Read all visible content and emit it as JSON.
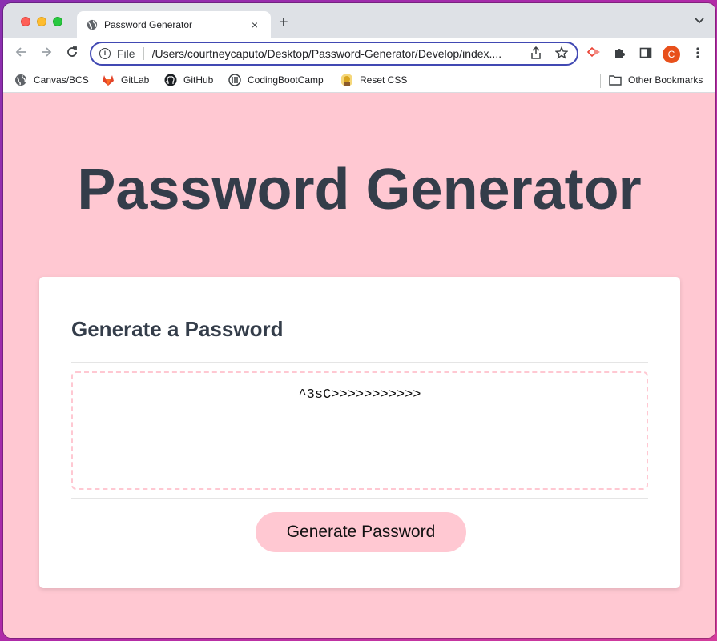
{
  "browser": {
    "tab": {
      "title": "Password Generator",
      "close": "×"
    },
    "new_tab": "+",
    "tab_menu": "⌄",
    "omnibox": {
      "scheme": "File",
      "url": "/Users/courtneycaputo/Desktop/Password-Generator/Develop/index...."
    },
    "profile_initial": "C",
    "bookmarks": [
      {
        "label": "Canvas/BCS",
        "icon": "globe-icon",
        "color": "#5f6368"
      },
      {
        "label": "GitLab",
        "icon": "gitlab-icon",
        "color": "#e24329"
      },
      {
        "label": "GitHub",
        "icon": "github-icon",
        "color": "#1b1f23"
      },
      {
        "label": "CodingBootCamp",
        "icon": "bootcamp-icon",
        "color": "#3c4043"
      },
      {
        "label": "Reset CSS",
        "icon": "reset-css-icon",
        "color": "#d9a520"
      }
    ],
    "other_bookmarks": "Other Bookmarks"
  },
  "page": {
    "title": "Password Generator",
    "card": {
      "header": "Generate a Password",
      "password": "^3sC>>>>>>>>>>>",
      "button": "Generate Password"
    }
  },
  "colors": {
    "page_bg": "#ffc8d2",
    "title_text": "#343d4a",
    "button_bg": "#ffc8d2",
    "omnibox_focus": "#4149b3",
    "avatar": "#e8501b"
  }
}
